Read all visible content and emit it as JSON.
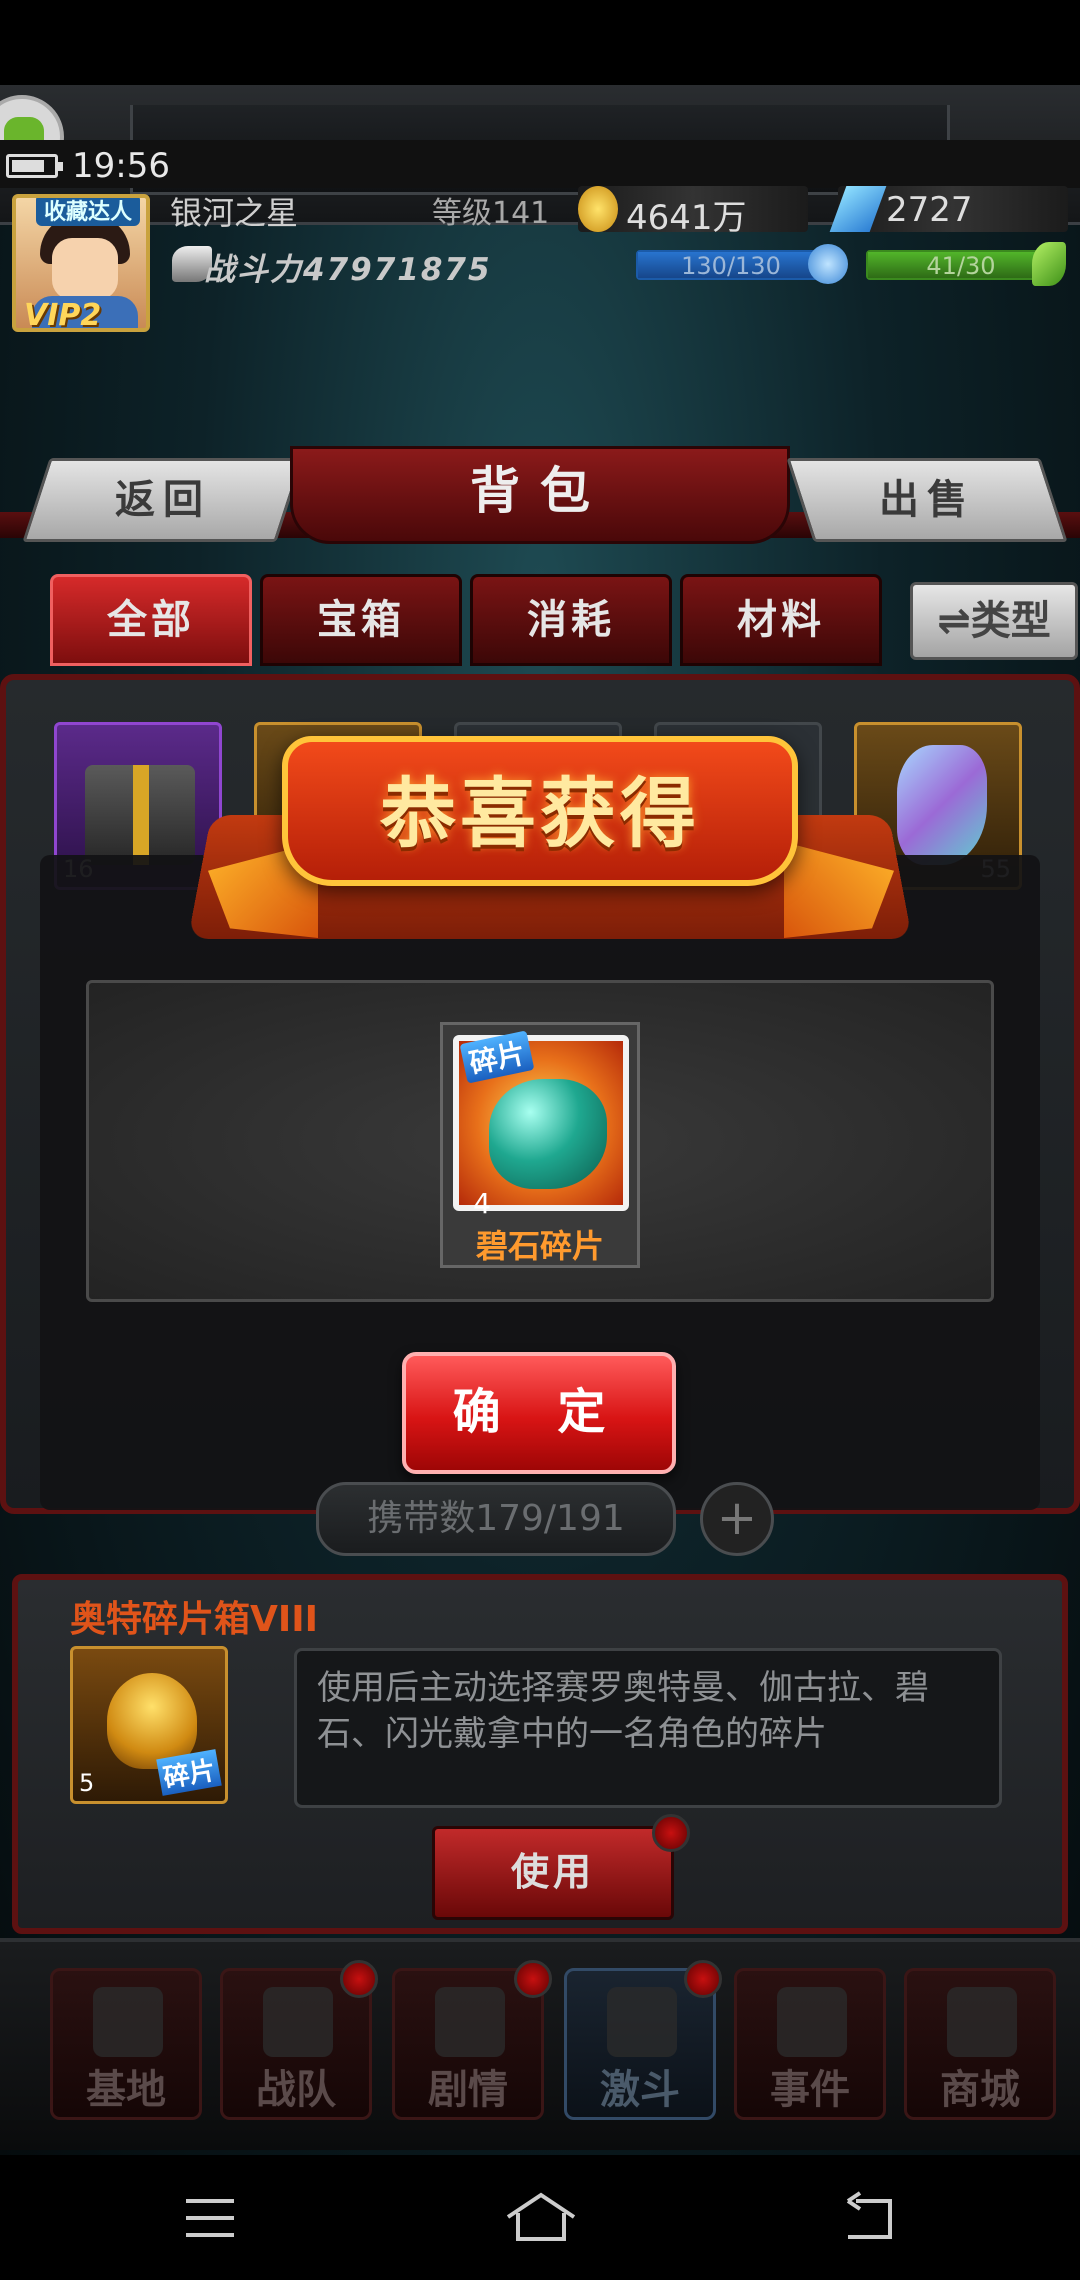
{
  "status": {
    "time": "19:56"
  },
  "player": {
    "name": "银河之星",
    "level_label": "等级141",
    "coins": "4641万",
    "gems": "2727",
    "power_label": "战斗力47971875",
    "vip": "VIP2",
    "title_badge": "收藏达人",
    "energy": "130/130",
    "stamina": "41/30"
  },
  "header": {
    "back": "返回",
    "title": "背包",
    "sell": "出售"
  },
  "tabs": [
    "全部",
    "宝箱",
    "消耗",
    "材料"
  ],
  "type_button": "⇌类型",
  "grid_counts": [
    "16",
    "55"
  ],
  "popup": {
    "title": "恭喜获得",
    "reward": {
      "tag": "碎片",
      "count": "4",
      "name": "碧石碎片"
    },
    "confirm": "确 定"
  },
  "capacity": {
    "label": "携带数179/191",
    "plus": "+"
  },
  "selected_item": {
    "name": "奥特碎片箱VIII",
    "tag": "碎片",
    "count": "5",
    "description": "使用后主动选择赛罗奥特曼、伽古拉、碧石、闪光戴拿中的一名角色的碎片",
    "use_button": "使用"
  },
  "bottom_nav": [
    "基地",
    "战队",
    "剧情",
    "激斗",
    "事件",
    "商城"
  ],
  "colors": {
    "accent_red": "#d81414",
    "gold": "#ffc43a",
    "reward_name": "#ff9a2e"
  }
}
